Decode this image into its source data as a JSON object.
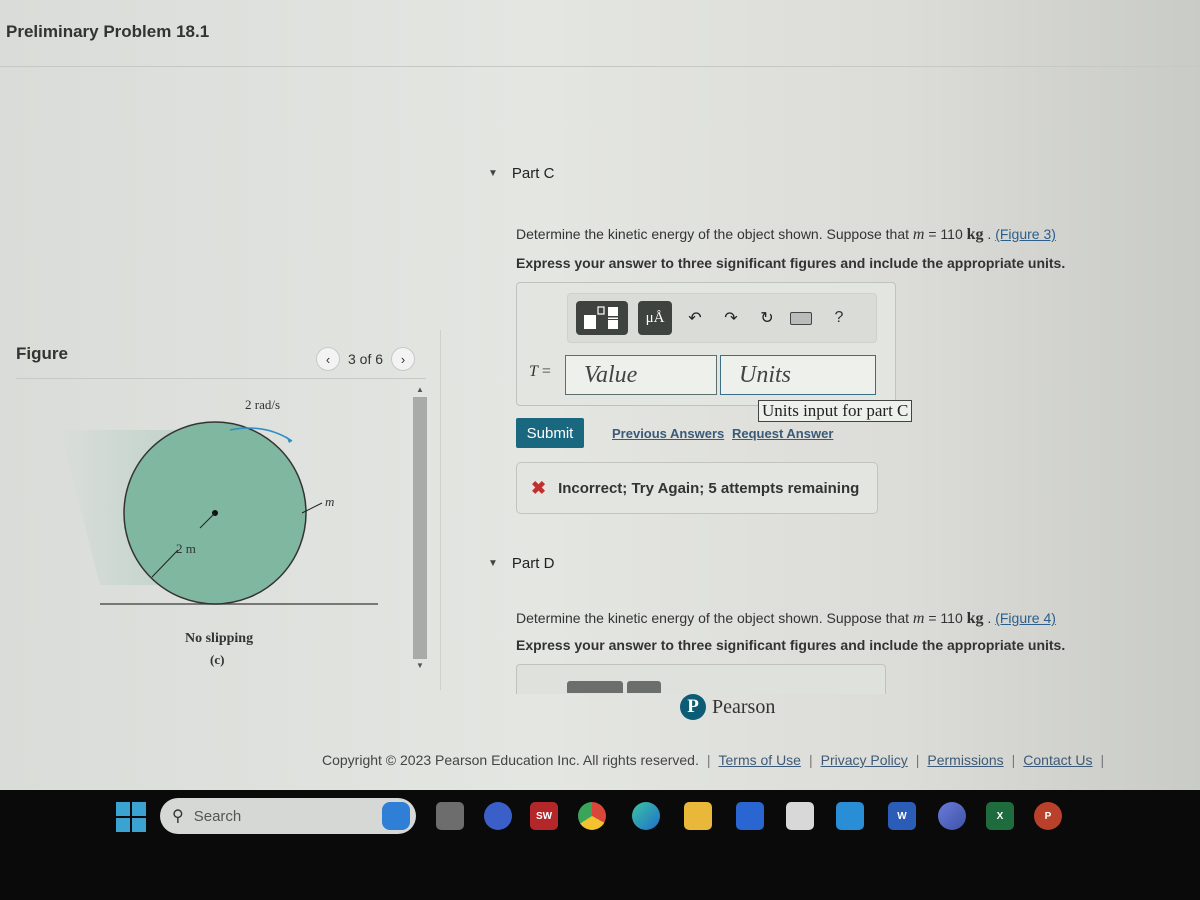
{
  "page": {
    "title": "Preliminary Problem 18.1"
  },
  "figure": {
    "label": "Figure",
    "counter": "3 of 6",
    "prev_icon": "chevron-left-icon",
    "next_icon": "chevron-right-icon",
    "angular_velocity_label": "2 rad/s",
    "radius_label": "2 m",
    "mass_label": "m",
    "caption": "No slipping",
    "sub_label": "(c)",
    "fill_color": "#7fb7a0"
  },
  "part_c": {
    "title": "Part C",
    "question_prefix": "Determine the kinetic energy of the object shown. Suppose that ",
    "mass_symbol": "m",
    "mass_value": " = 110 ",
    "mass_unit": "kg",
    "figure_link": "(Figure 3)",
    "instruction": "Express your answer to three significant figures and include the appropriate units.",
    "toolbar": {
      "templates_icon": "templates-icon",
      "units_label": "μÅ",
      "undo_icon": "↶",
      "redo_icon": "↷",
      "reset_icon": "↻",
      "keyboard_icon": "keyboard-icon",
      "help_label": "?"
    },
    "variable": "T",
    "equals": " =",
    "value_placeholder": "Value",
    "units_placeholder": "Units",
    "units_tooltip": "Units input for part C",
    "submit_label": "Submit",
    "previous_answers_label": "Previous Answers",
    "request_answer_label": "Request Answer",
    "feedback": {
      "status": "incorrect",
      "text": "Incorrect; Try Again; 5 attempts remaining",
      "color": "#c0302e"
    }
  },
  "part_d": {
    "title": "Part D",
    "question_prefix": "Determine the kinetic energy of the object shown. Suppose that ",
    "mass_symbol": "m",
    "mass_value": " = 110 ",
    "mass_unit": "kg",
    "figure_link": "(Figure 4)",
    "instruction": "Express your answer to three significant figures and include the appropriate units."
  },
  "branding": {
    "logo_letter": "P",
    "name": "Pearson",
    "color": "#0c5c76"
  },
  "footer": {
    "copyright": "Copyright © 2023 Pearson Education Inc. All rights reserved.",
    "links": [
      "Terms of Use",
      "Privacy Policy",
      "Permissions",
      "Contact Us"
    ]
  },
  "taskbar": {
    "search_label": "Search",
    "apps": [
      {
        "name": "task-view",
        "label": ""
      },
      {
        "name": "meet",
        "label": ""
      },
      {
        "name": "solidworks",
        "label": "SW"
      },
      {
        "name": "chrome",
        "label": ""
      },
      {
        "name": "edge",
        "label": ""
      },
      {
        "name": "file-explorer",
        "label": ""
      },
      {
        "name": "dropbox",
        "label": ""
      },
      {
        "name": "microsoft-store",
        "label": ""
      },
      {
        "name": "mail",
        "label": ""
      },
      {
        "name": "word",
        "label": "W"
      },
      {
        "name": "copilot",
        "label": ""
      },
      {
        "name": "excel",
        "label": "X"
      },
      {
        "name": "powerpoint",
        "label": "P"
      }
    ]
  }
}
